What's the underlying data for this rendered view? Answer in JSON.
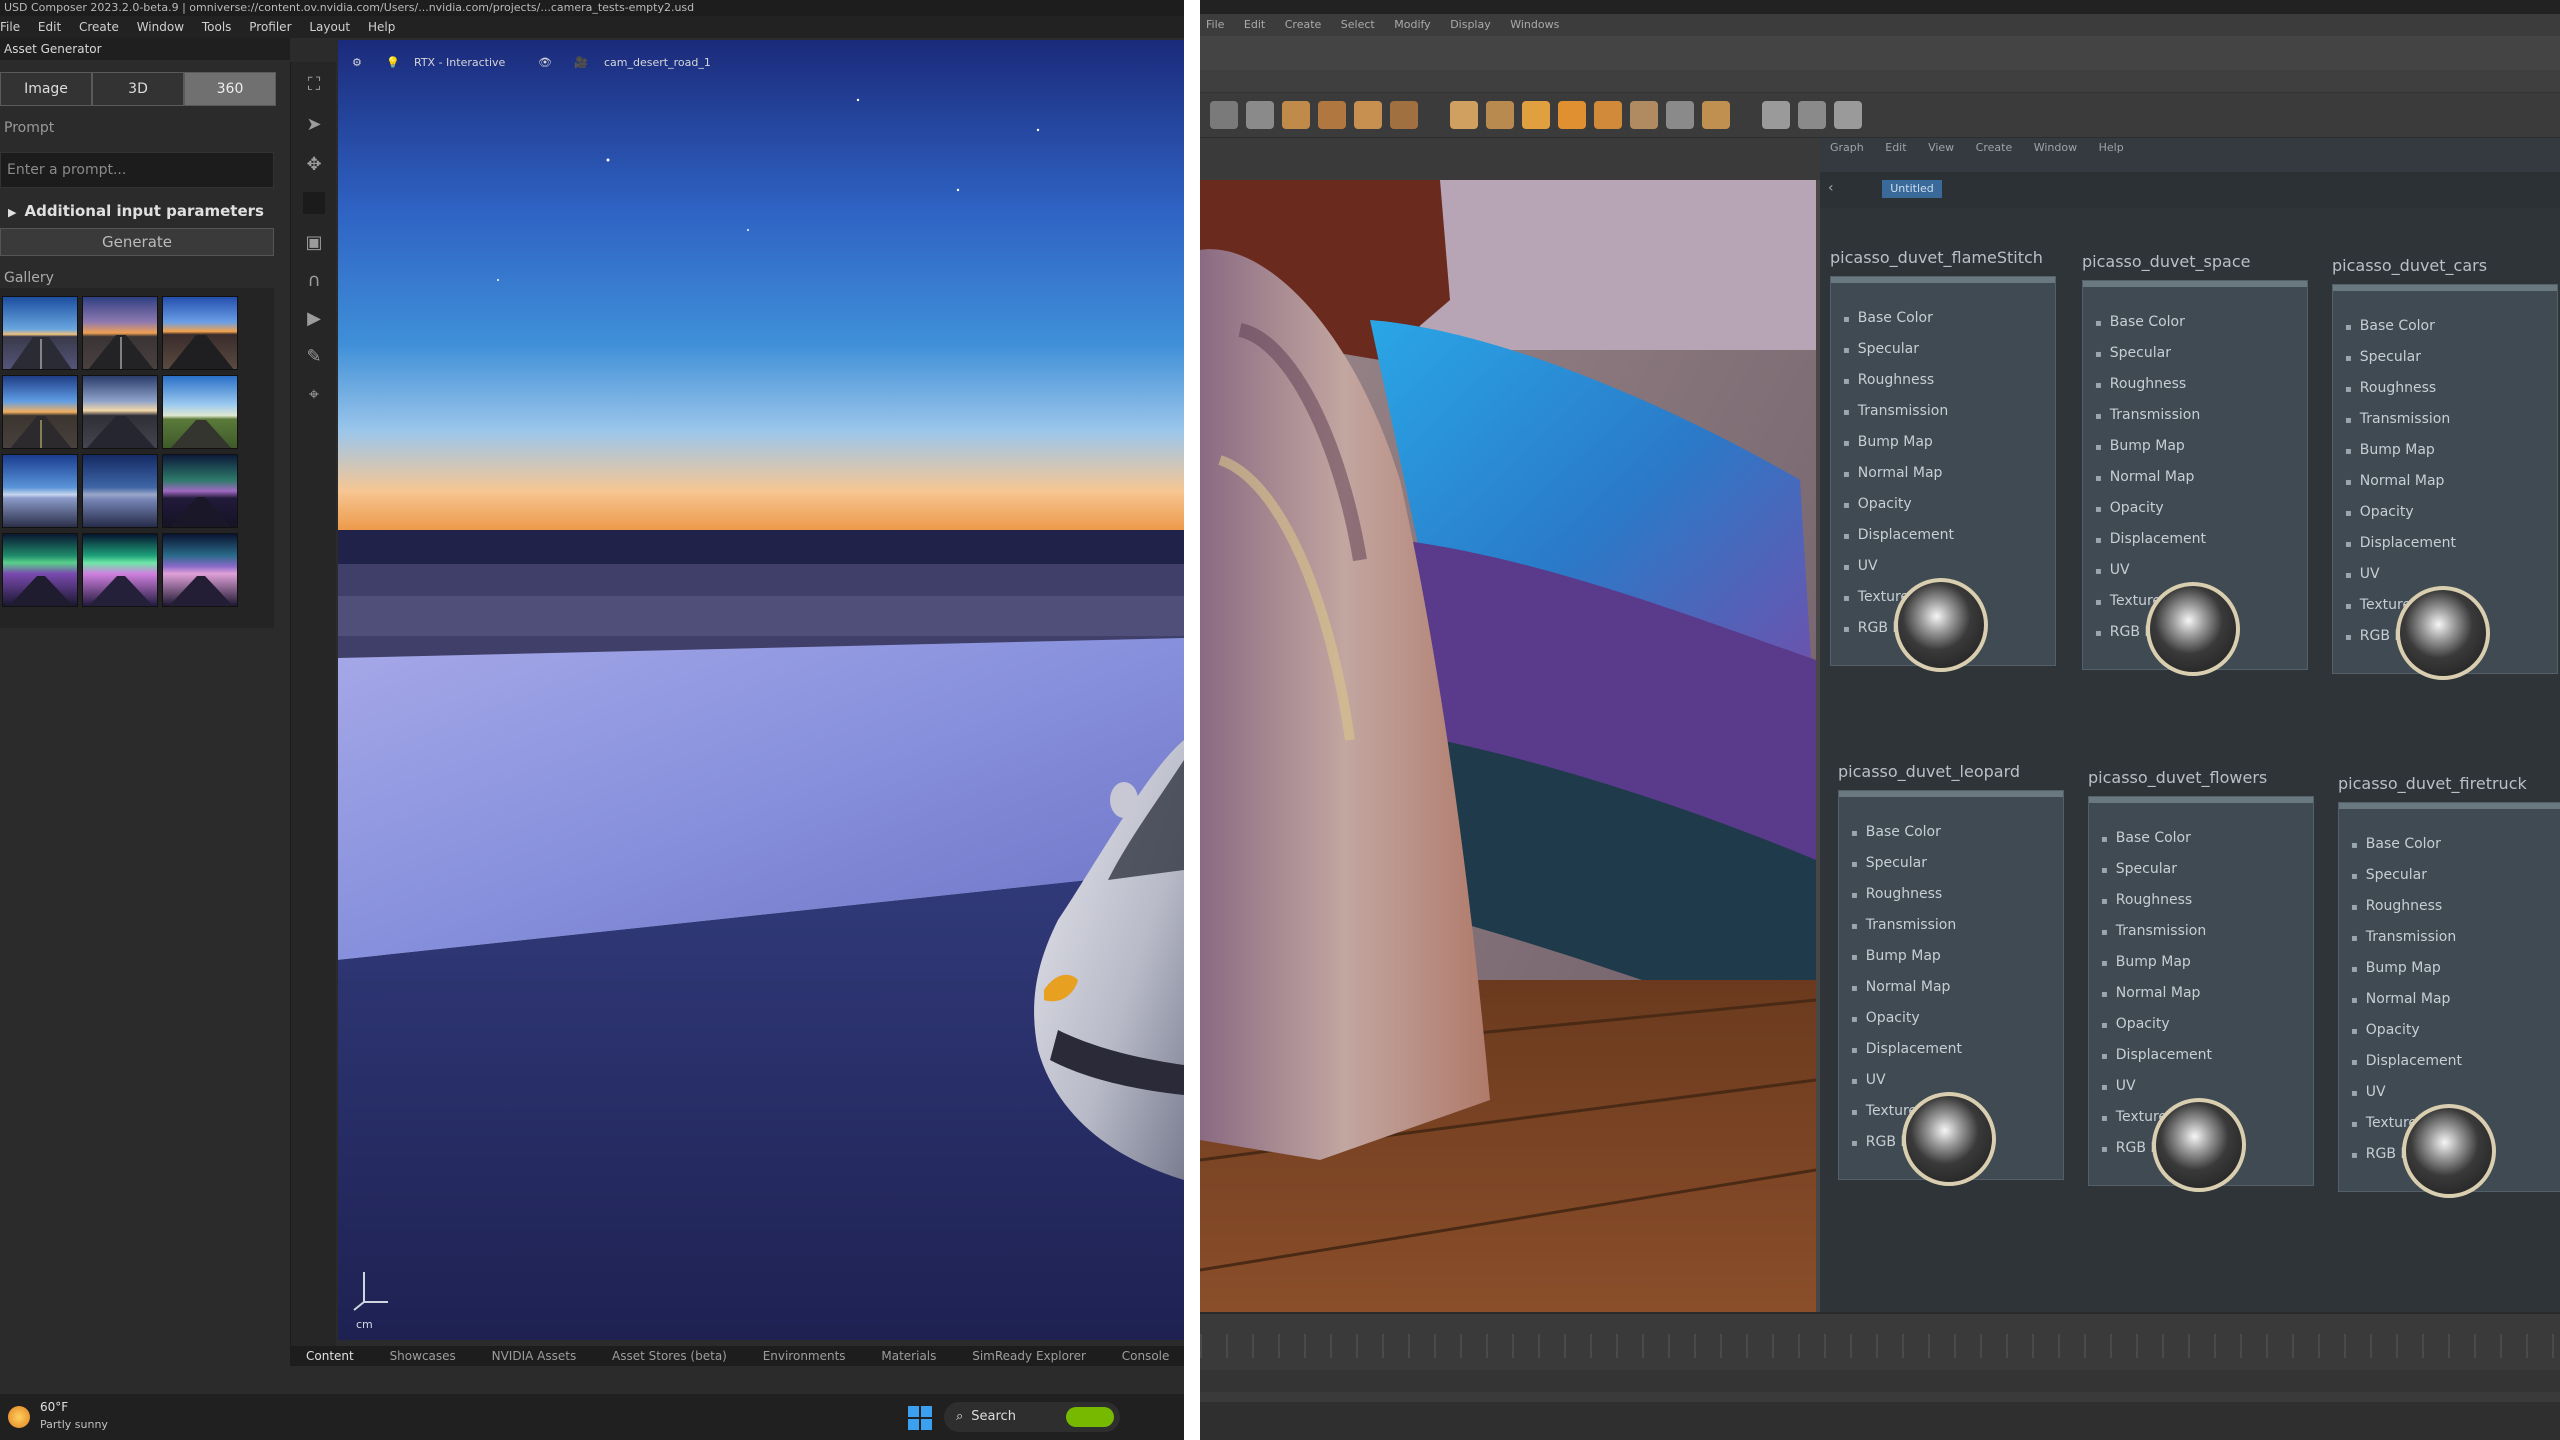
{
  "left_app": {
    "title": "USD Composer   2023.2.0-beta.9 | omniverse://content.ov.nvidia.com/Users/...nvidia.com/projects/...camera_tests-empty2.usd",
    "menu": [
      "File",
      "Edit",
      "Create",
      "Window",
      "Tools",
      "Profiler",
      "Layout",
      "Help"
    ],
    "panel_title": "Asset Generator",
    "modes": [
      "Image",
      "3D",
      "360"
    ],
    "selected_mode": "360",
    "prompt_label": "Prompt",
    "prompt_placeholder": "Enter a prompt...",
    "additional_params": "Additional input parameters",
    "generate_label": "Generate",
    "gallery_label": "Gallery",
    "viewport_toolbar": {
      "render_mode": "RTX - Interactive",
      "camera": "cam_desert_road_1"
    },
    "axis_unit": "cm",
    "bottom_tabs": [
      "Content",
      "Showcases",
      "NVIDIA Assets",
      "Asset Stores (beta)",
      "Environments",
      "Materials",
      "SimReady Explorer",
      "Console"
    ],
    "taskbar": {
      "temperature": "60°F",
      "weather": "Partly sunny",
      "search_label": "Search"
    }
  },
  "right_app": {
    "menu": [
      "File",
      "Edit",
      "Create",
      "Select",
      "Modify",
      "Display",
      "Windows"
    ],
    "hypershade_menu": [
      "Graph",
      "Edit",
      "View",
      "Create",
      "Window",
      "Help"
    ],
    "hypershade_tab": "Untitled",
    "nodes": [
      {
        "title": "picasso_duvet_flameStitch"
      },
      {
        "title": "picasso_duvet_space"
      },
      {
        "title": "picasso_duvet_cars"
      },
      {
        "title": "picasso_duvet_leopard"
      },
      {
        "title": "picasso_duvet_flowers"
      },
      {
        "title": "picasso_duvet_firetruck"
      }
    ],
    "attributes": [
      "Base Color",
      "Specular",
      "Roughness",
      "Transmission",
      "Bump Map",
      "Normal Map",
      "Opacity",
      "Displacement",
      "UV",
      "Textures",
      "RGB Masks"
    ]
  },
  "colors": {
    "sky_top": "#1b2a7a",
    "sky_mid": "#3f8fd8",
    "horizon": "#ee9a4a",
    "node_body": "#3f4a52",
    "knob_ring": "#d9cfb0"
  }
}
